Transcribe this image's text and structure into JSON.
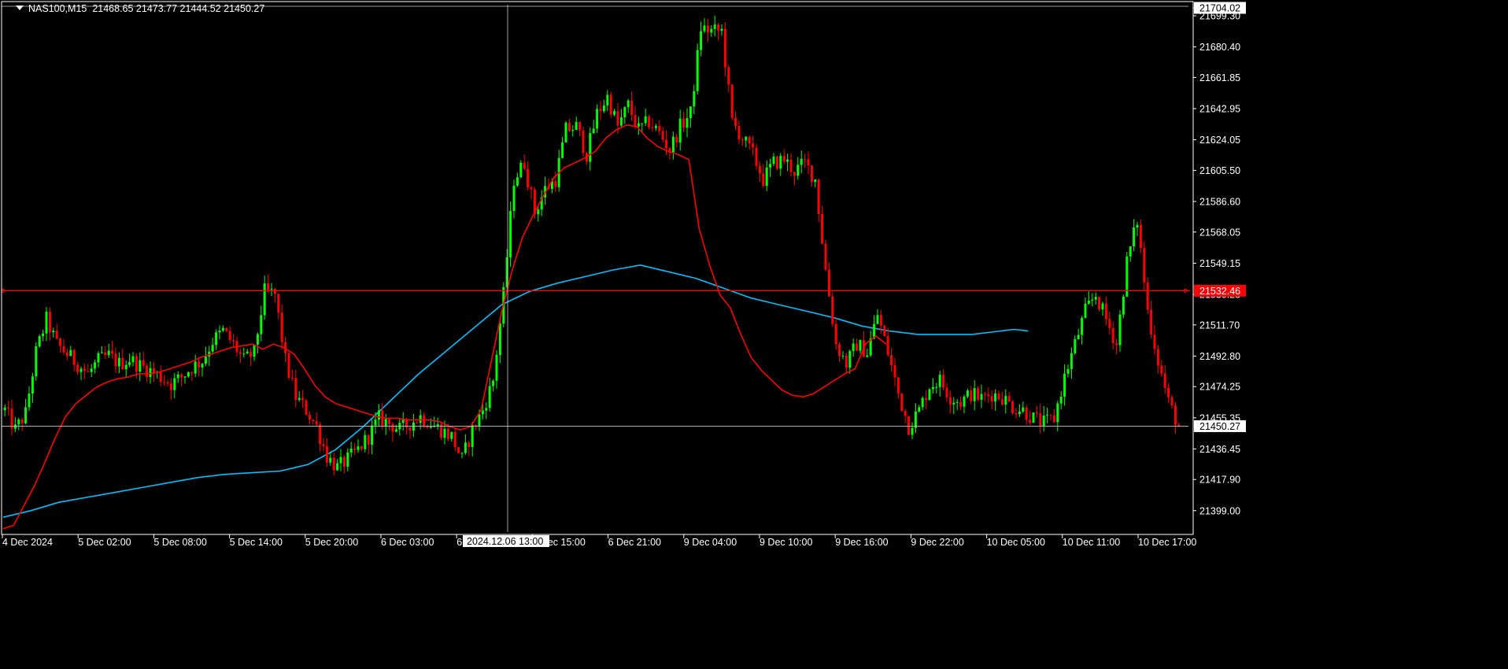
{
  "header": {
    "symbol": "NAS100,M15",
    "ohlc": "21468.65 21473.77 21444.52 21450.27"
  },
  "crosshair": {
    "time_label": "2024.12.06 13:00"
  },
  "colors": {
    "background": "#000000",
    "axis": "#ffffff",
    "bull_candle": "#00ff00",
    "bear_candle": "#ff0000",
    "ma_fast": "#ff0000",
    "ma_slow": "#00bfff",
    "horizontal_level": "#ff0000",
    "price_marker_bg": "#ff0000",
    "current_price_bg": "#ffffff",
    "crosshair": "#c8c8c8",
    "gridline_current": "#c8c8c8"
  },
  "chart_data": {
    "type": "candlestick",
    "symbol": "NAS100",
    "timeframe": "M15",
    "ylim": [
      21386,
      21706
    ],
    "y_ticks": [
      "21704.02",
      "21699.30",
      "21680.40",
      "21661.85",
      "21642.95",
      "21624.05",
      "21605.50",
      "21586.60",
      "21568.05",
      "21549.15",
      "21530.25",
      "21511.70",
      "21492.80",
      "21474.25",
      "21455.35",
      "21436.45",
      "21417.90",
      "21399.00"
    ],
    "x_ticks": [
      "4 Dec 2024",
      "5 Dec 02:00",
      "5 Dec 08:00",
      "5 Dec 14:00",
      "5 Dec 20:00",
      "6 Dec 03:00",
      "6 Dec 09:00",
      "6 Dec 15:00",
      "6 Dec 21:00",
      "9 Dec 04:00",
      "9 Dec 10:00",
      "9 Dec 16:00",
      "9 Dec 22:00",
      "10 Dec 05:00",
      "10 Dec 11:00",
      "10 Dec 17:00"
    ],
    "horizontal_level": 21532.46,
    "horizontal_level_label": "21532.46",
    "current_price": 21450.27,
    "current_price_label": "21450.27",
    "top_price_label": "21704.02",
    "price_path": [
      [
        0,
        21460
      ],
      [
        3,
        21448
      ],
      [
        6,
        21458
      ],
      [
        9,
        21495
      ],
      [
        12,
        21515
      ],
      [
        15,
        21500
      ],
      [
        18,
        21494
      ],
      [
        21,
        21488
      ],
      [
        24,
        21482
      ],
      [
        27,
        21490
      ],
      [
        30,
        21493
      ],
      [
        33,
        21488
      ],
      [
        36,
        21491
      ],
      [
        39,
        21487
      ],
      [
        42,
        21484
      ],
      [
        45,
        21480
      ],
      [
        48,
        21476
      ],
      [
        51,
        21480
      ],
      [
        54,
        21486
      ],
      [
        57,
        21490
      ],
      [
        60,
        21502
      ],
      [
        63,
        21508
      ],
      [
        66,
        21500
      ],
      [
        69,
        21490
      ],
      [
        72,
        21495
      ],
      [
        75,
        21532
      ],
      [
        78,
        21530
      ],
      [
        81,
        21490
      ],
      [
        84,
        21468
      ],
      [
        87,
        21460
      ],
      [
        90,
        21450
      ],
      [
        93,
        21432
      ],
      [
        96,
        21425
      ],
      [
        99,
        21430
      ],
      [
        102,
        21436
      ],
      [
        105,
        21444
      ],
      [
        108,
        21455
      ],
      [
        111,
        21452
      ],
      [
        114,
        21448
      ],
      [
        117,
        21452
      ],
      [
        120,
        21456
      ],
      [
        123,
        21452
      ],
      [
        126,
        21448
      ],
      [
        129,
        21444
      ],
      [
        132,
        21430
      ],
      [
        135,
        21448
      ],
      [
        138,
        21460
      ],
      [
        141,
        21478
      ],
      [
        144,
        21530
      ],
      [
        147,
        21600
      ],
      [
        150,
        21610
      ],
      [
        153,
        21580
      ],
      [
        156,
        21594
      ],
      [
        159,
        21600
      ],
      [
        162,
        21630
      ],
      [
        165,
        21632
      ],
      [
        168,
        21615
      ],
      [
        171,
        21640
      ],
      [
        174,
        21650
      ],
      [
        177,
        21632
      ],
      [
        180,
        21645
      ],
      [
        183,
        21630
      ],
      [
        186,
        21635
      ],
      [
        189,
        21628
      ],
      [
        192,
        21618
      ],
      [
        195,
        21632
      ],
      [
        198,
        21640
      ],
      [
        201,
        21692
      ],
      [
        204,
        21690
      ],
      [
        207,
        21690
      ],
      [
        210,
        21635
      ],
      [
        213,
        21625
      ],
      [
        216,
        21615
      ],
      [
        219,
        21600
      ],
      [
        222,
        21610
      ],
      [
        225,
        21612
      ],
      [
        228,
        21605
      ],
      [
        231,
        21610
      ],
      [
        234,
        21600
      ],
      [
        237,
        21545
      ],
      [
        240,
        21500
      ],
      [
        243,
        21488
      ],
      [
        246,
        21500
      ],
      [
        249,
        21495
      ],
      [
        252,
        21518
      ],
      [
        255,
        21495
      ],
      [
        258,
        21470
      ],
      [
        261,
        21450
      ],
      [
        264,
        21460
      ],
      [
        267,
        21475
      ],
      [
        270,
        21478
      ],
      [
        273,
        21468
      ],
      [
        276,
        21465
      ],
      [
        279,
        21470
      ],
      [
        282,
        21467
      ],
      [
        285,
        21470
      ],
      [
        288,
        21468
      ],
      [
        291,
        21462
      ],
      [
        294,
        21460
      ],
      [
        297,
        21455
      ],
      [
        300,
        21452
      ],
      [
        303,
        21455
      ],
      [
        306,
        21480
      ],
      [
        309,
        21500
      ],
      [
        312,
        21520
      ],
      [
        315,
        21530
      ],
      [
        318,
        21515
      ],
      [
        321,
        21500
      ],
      [
        324,
        21550
      ],
      [
        327,
        21575
      ],
      [
        330,
        21520
      ],
      [
        333,
        21490
      ],
      [
        336,
        21465
      ],
      [
        339,
        21450
      ]
    ],
    "ma_fast": [
      [
        0,
        21388
      ],
      [
        3,
        21390
      ],
      [
        6,
        21402
      ],
      [
        9,
        21414
      ],
      [
        12,
        21428
      ],
      [
        15,
        21443
      ],
      [
        18,
        21456
      ],
      [
        21,
        21464
      ],
      [
        24,
        21469
      ],
      [
        27,
        21474
      ],
      [
        30,
        21477
      ],
      [
        33,
        21479
      ],
      [
        36,
        21480
      ],
      [
        39,
        21482
      ],
      [
        42,
        21482
      ],
      [
        45,
        21483
      ],
      [
        48,
        21485
      ],
      [
        51,
        21487
      ],
      [
        54,
        21489
      ],
      [
        57,
        21492
      ],
      [
        60,
        21494
      ],
      [
        63,
        21496
      ],
      [
        66,
        21498
      ],
      [
        69,
        21499
      ],
      [
        72,
        21500
      ],
      [
        75,
        21497
      ],
      [
        78,
        21500
      ],
      [
        81,
        21498
      ],
      [
        84,
        21494
      ],
      [
        87,
        21485
      ],
      [
        90,
        21475
      ],
      [
        93,
        21468
      ],
      [
        96,
        21464
      ],
      [
        99,
        21462
      ],
      [
        102,
        21460
      ],
      [
        105,
        21458
      ],
      [
        108,
        21456
      ],
      [
        111,
        21455
      ],
      [
        114,
        21455
      ],
      [
        117,
        21454
      ],
      [
        120,
        21454
      ],
      [
        123,
        21454
      ],
      [
        126,
        21453
      ],
      [
        129,
        21450
      ],
      [
        132,
        21448
      ],
      [
        135,
        21450
      ],
      [
        138,
        21460
      ],
      [
        141,
        21490
      ],
      [
        144,
        21520
      ],
      [
        147,
        21545
      ],
      [
        150,
        21565
      ],
      [
        153,
        21578
      ],
      [
        156,
        21590
      ],
      [
        159,
        21601
      ],
      [
        162,
        21607
      ],
      [
        165,
        21610
      ],
      [
        168,
        21613
      ],
      [
        171,
        21617
      ],
      [
        174,
        21625
      ],
      [
        177,
        21630
      ],
      [
        180,
        21633
      ],
      [
        183,
        21632
      ],
      [
        186,
        21625
      ],
      [
        189,
        21620
      ],
      [
        192,
        21617
      ],
      [
        195,
        21615
      ],
      [
        198,
        21612
      ],
      [
        201,
        21570
      ],
      [
        204,
        21548
      ],
      [
        207,
        21530
      ],
      [
        210,
        21522
      ],
      [
        213,
        21506
      ],
      [
        216,
        21492
      ],
      [
        219,
        21484
      ],
      [
        222,
        21478
      ],
      [
        225,
        21472
      ],
      [
        228,
        21469
      ],
      [
        231,
        21468
      ],
      [
        234,
        21470
      ],
      [
        237,
        21474
      ],
      [
        240,
        21478
      ],
      [
        243,
        21482
      ],
      [
        246,
        21485
      ],
      [
        249,
        21500
      ],
      [
        252,
        21505
      ],
      [
        255,
        21500
      ]
    ],
    "ma_slow": [
      [
        0,
        21395
      ],
      [
        8,
        21399
      ],
      [
        16,
        21404
      ],
      [
        24,
        21407
      ],
      [
        32,
        21410
      ],
      [
        40,
        21413
      ],
      [
        48,
        21416
      ],
      [
        56,
        21419
      ],
      [
        64,
        21421
      ],
      [
        72,
        21422
      ],
      [
        80,
        21423
      ],
      [
        88,
        21427
      ],
      [
        96,
        21436
      ],
      [
        104,
        21450
      ],
      [
        112,
        21466
      ],
      [
        120,
        21482
      ],
      [
        128,
        21496
      ],
      [
        136,
        21510
      ],
      [
        144,
        21524
      ],
      [
        152,
        21532
      ],
      [
        160,
        21537
      ],
      [
        168,
        21541
      ],
      [
        176,
        21545
      ],
      [
        184,
        21548
      ],
      [
        192,
        21544
      ],
      [
        200,
        21540
      ],
      [
        208,
        21534
      ],
      [
        216,
        21528
      ],
      [
        224,
        21524
      ],
      [
        232,
        21520
      ],
      [
        240,
        21516
      ],
      [
        248,
        21511
      ],
      [
        256,
        21508
      ],
      [
        264,
        21506
      ],
      [
        272,
        21506
      ],
      [
        280,
        21506
      ],
      [
        288,
        21508
      ],
      [
        292,
        21509
      ],
      [
        296,
        21508
      ]
    ]
  }
}
